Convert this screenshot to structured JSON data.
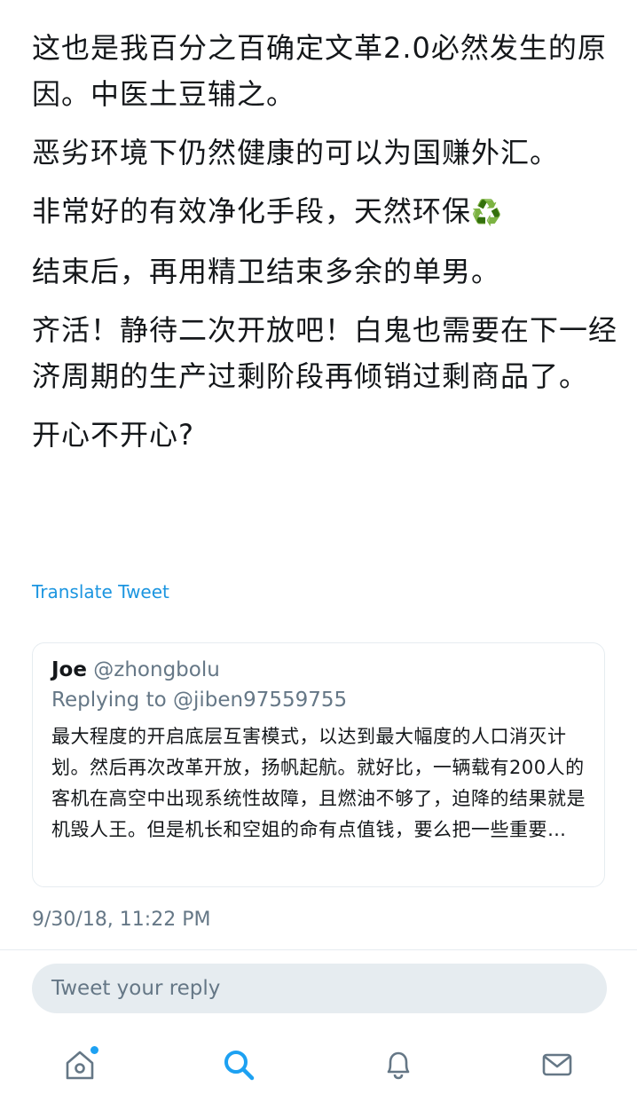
{
  "tweet": {
    "paragraphs": [
      "这也是我百分之百确定文革2.0必然发生的原因。中医土豆辅之。",
      "恶劣环境下仍然健康的可以为国赚外汇。",
      "非常好的有效净化手段，天然环保",
      "结束后，再用精卫结束多余的单男。",
      "齐活！静待二次开放吧！白鬼也需要在下一经济周期的生产过剩阶段再倾销过剩商品了。",
      "开心不开心?"
    ],
    "recycle_emoji": "♻️",
    "translate_label": "Translate Tweet",
    "timestamp": "9/30/18, 11:22 PM"
  },
  "quoted": {
    "name": "Joe",
    "handle": "@zhongbolu",
    "replying_label": "Replying to",
    "replying_to": "@jiben97559755",
    "text": "最大程度的开启底层互害模式，以达到最大幅度的人口消灭计划。然后再次改革开放，扬帆起航。就好比，一辆载有200人的客机在高空中出现系统性故障，且燃油不够了，迫降的结果就是机毁人王。但是机长和空姐的命有点值钱，要么把一些重要…"
  },
  "reply": {
    "placeholder": "Tweet your reply"
  },
  "tabbar": {
    "icons": [
      "home-icon",
      "search-icon",
      "bell-icon",
      "mail-icon"
    ],
    "active": "search-icon",
    "accent": "#1da1f2",
    "inactive": "#657786"
  }
}
